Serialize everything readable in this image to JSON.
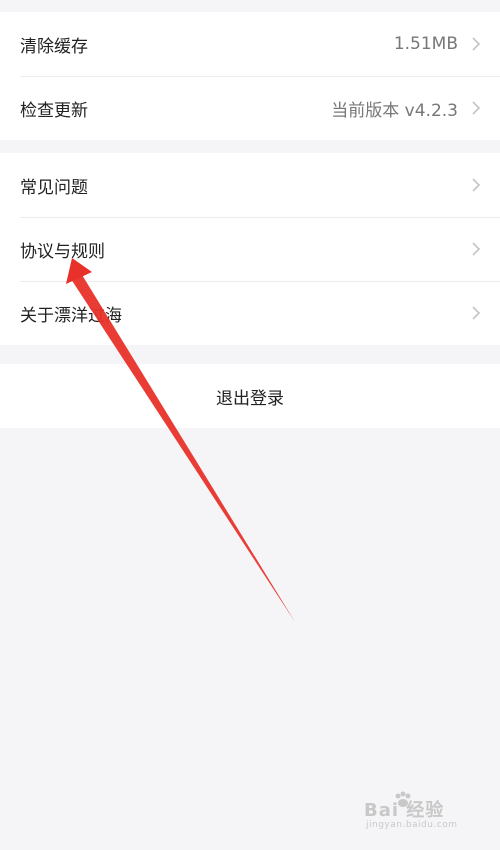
{
  "settings": {
    "group1": [
      {
        "label": "清除缓存",
        "value": "1.51MB"
      },
      {
        "label": "检查更新",
        "value": "当前版本 v4.2.3"
      }
    ],
    "group2": [
      {
        "label": "常见问题"
      },
      {
        "label": "协议与规则"
      },
      {
        "label": "关于漂洋过海"
      }
    ],
    "logout_label": "退出登录"
  },
  "annotation": {
    "arrow_color": "#e8312a"
  },
  "watermark": {
    "brand": "Bai 经验",
    "url": "jingyan.baidu.com"
  },
  "colors": {
    "background": "#f5f5f7",
    "card": "#ffffff",
    "divider": "#ececec"
  }
}
